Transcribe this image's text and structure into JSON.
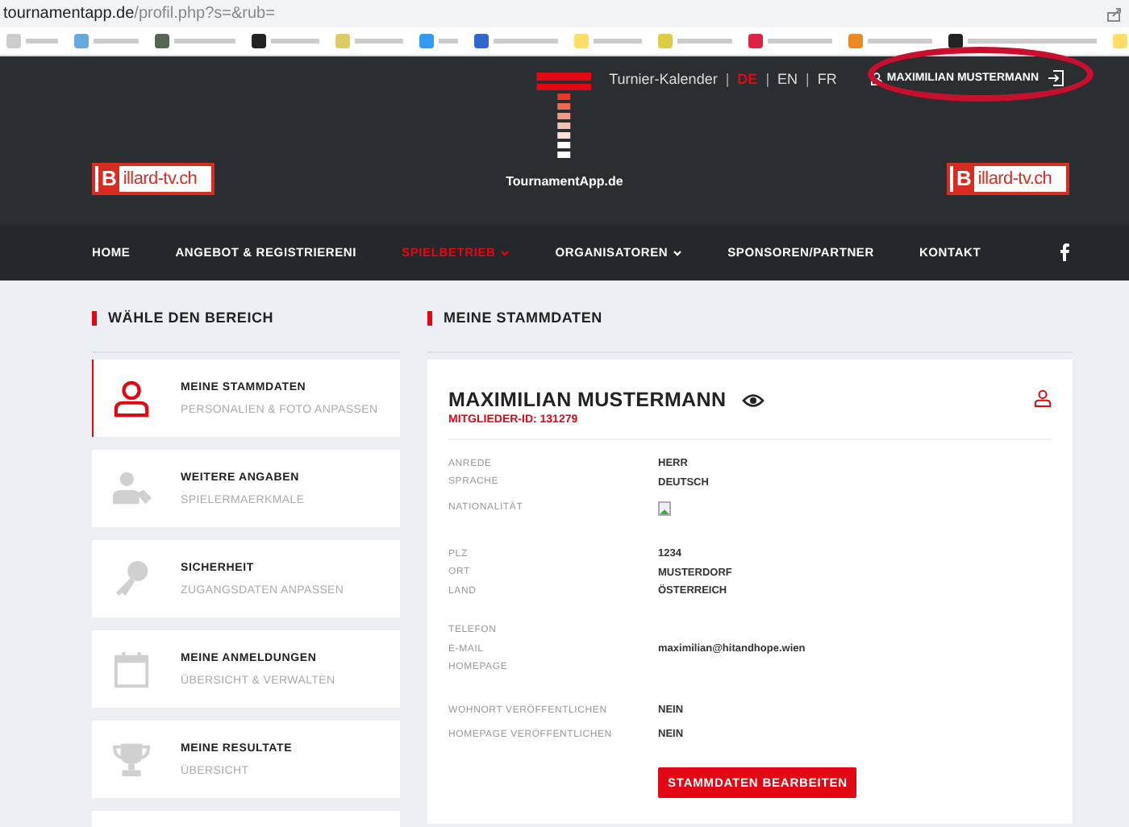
{
  "browser": {
    "url_host": "tournamentapp.de",
    "url_path": "/profil.php?s=&rub="
  },
  "header": {
    "calendar_link": "Turnier-Kalender",
    "separators": [
      "|",
      "|",
      "|"
    ],
    "languages": [
      {
        "label": "DE",
        "selected": true
      },
      {
        "label": "EN",
        "selected": false
      },
      {
        "label": "FR",
        "selected": false
      }
    ],
    "user": "MAXIMILIAN MUSTERMANN",
    "logo_text": "TournamentApp.de",
    "partner_logos": [
      {
        "initial": "B",
        "text": "illard-tv.ch"
      },
      {
        "initial": "B",
        "text": "illard-tv.ch"
      }
    ],
    "nav": [
      {
        "label": "HOME",
        "selected": false,
        "dropdown": false
      },
      {
        "label": "ANGEBOT & REGISTRIERENI",
        "selected": false,
        "dropdown": false
      },
      {
        "label": "SPIELBETRIEB",
        "selected": true,
        "dropdown": true
      },
      {
        "label": "ORGANISATOREN",
        "selected": false,
        "dropdown": true
      },
      {
        "label": "SPONSOREN/PARTNER",
        "selected": false,
        "dropdown": false
      },
      {
        "label": "KONTAKT",
        "selected": false,
        "dropdown": false
      }
    ]
  },
  "sidebar": {
    "title": "WÄHLE DEN BEREICH",
    "items": [
      {
        "title": "MEINE STAMMDATEN",
        "subtitle": "PERSONALIEN & FOTO ANPASSEN",
        "kind": "person",
        "selected": true
      },
      {
        "title": "WEITERE ANGABEN",
        "subtitle": "SPIELERMAERKMALE",
        "kind": "person-tag",
        "selected": false
      },
      {
        "title": "SICHERHEIT",
        "subtitle": "ZUGANGSDATEN ANPASSEN",
        "kind": "key",
        "selected": false
      },
      {
        "title": "MEINE ANMELDUNGEN",
        "subtitle": "ÜBERSICHT & VERWALTEN",
        "kind": "calendar",
        "selected": false
      },
      {
        "title": "MEINE RESULTATE",
        "subtitle": "ÜBERSICHT",
        "kind": "trophy",
        "selected": false
      }
    ]
  },
  "main": {
    "title": "MEINE STAMMDATEN",
    "name": "MAXIMILIAN MUSTERMANN",
    "member_id": "MITGLIEDER-ID: 131279",
    "groups": [
      [
        {
          "label": "ANREDE",
          "value": "HERR",
          "kind": "text"
        },
        {
          "label": "SPRACHE",
          "value": "DEUTSCH",
          "kind": "text"
        },
        {
          "label": "NATIONALITÄT",
          "kind": "image"
        }
      ],
      [
        {
          "label": "PLZ",
          "value": "1234",
          "kind": "text"
        },
        {
          "label": "ORT",
          "value": "MUSTERDORF",
          "kind": "text"
        },
        {
          "label": "LAND",
          "value": "ÖSTERREICH",
          "kind": "text"
        }
      ],
      [
        {
          "label": "TELEFON",
          "kind": "text"
        },
        {
          "label": "E-MAIL",
          "value": "maximilian@hitandhope.wien",
          "kind": "text"
        },
        {
          "label": "HOMEPAGE",
          "kind": "text"
        }
      ],
      [
        {
          "label": "WOHNORT VERÖFFENTLICHEN",
          "value": "NEIN",
          "kind": "text"
        },
        {
          "label": "HOMEPAGE VERÖFFENTLICHEN",
          "value": "NEIN",
          "kind": "text"
        }
      ]
    ],
    "button": "STAMMDATEN BEARBEITEN"
  }
}
